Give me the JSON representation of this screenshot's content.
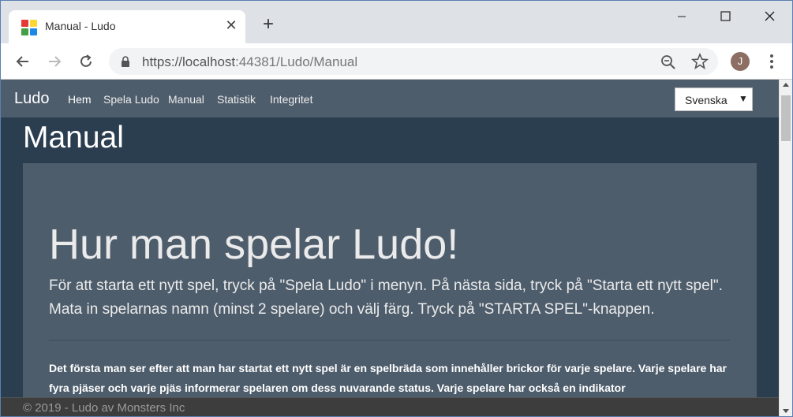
{
  "browser": {
    "tab_title": "Manual - Ludo",
    "url_host": "https://localhost",
    "url_port_path": ":44381/Ludo/Manual",
    "avatar_letter": "J"
  },
  "navbar": {
    "brand": "Ludo",
    "links": [
      "Hem",
      "Spela Ludo",
      "Manual",
      "Statistik",
      "Integritet"
    ],
    "active_link": "Hem",
    "language_selected": "Svenska"
  },
  "main": {
    "page_title": "Manual",
    "heading": "Hur man spelar Ludo!",
    "lead": "För att starta ett nytt spel, tryck på \"Spela Ludo\" i menyn. På nästa sida, tryck på \"Starta ett nytt spel\". Mata in spelarnas namn (minst 2 spelare) och välj färg. Tryck på \"STARTA SPEL\"-knappen.",
    "body": "Det första man ser efter att man har startat ett nytt spel är en spelbräda som innehåller brickor för varje spelare. Varje spelare har fyra pjäser och varje pjäs informerar spelaren om dess nuvarande status. Varje spelare har också en indikator"
  },
  "footer": {
    "text": "© 2019 - Ludo av Monsters Inc"
  },
  "colors": {
    "page_bg": "#2b3e50",
    "navbar_bg": "#4e5d6c",
    "jumbotron_bg": "#4e5d6c",
    "footer_bg": "#3d3d3d"
  },
  "icons": [
    "favicon-icon",
    "close-icon",
    "new-tab-icon",
    "minimize-icon",
    "maximize-icon",
    "window-close-icon",
    "back-icon",
    "forward-icon",
    "reload-icon",
    "lock-icon",
    "zoom-icon",
    "star-icon",
    "menu-icon"
  ]
}
